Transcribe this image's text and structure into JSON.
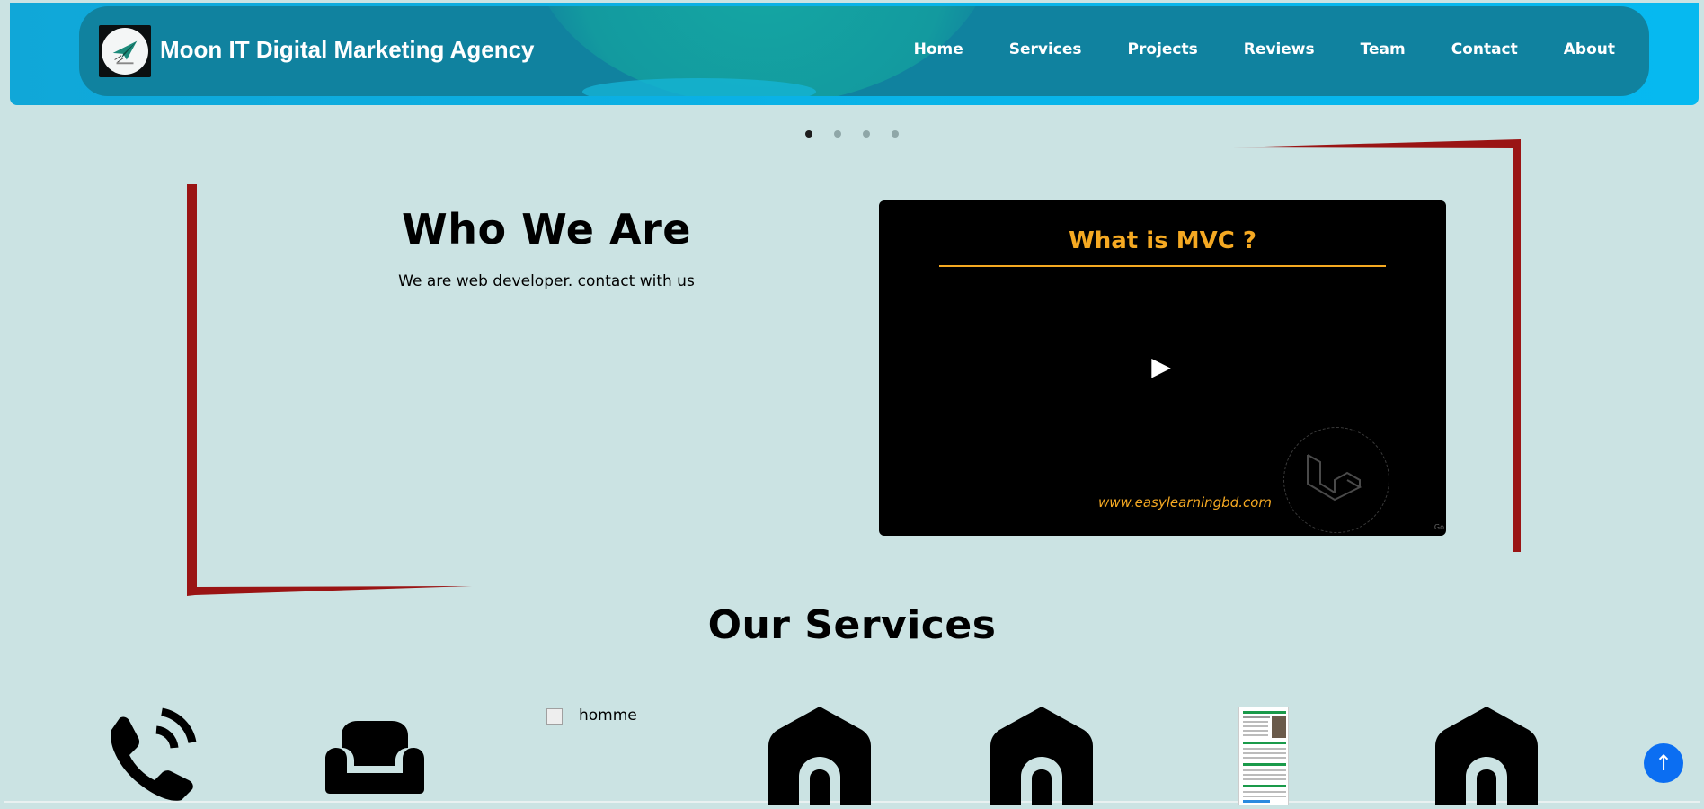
{
  "header": {
    "brand": "Moon IT Digital Marketing Agency",
    "logo_icon": "paper-plane-logo-icon",
    "nav": [
      "Home",
      "Services",
      "Projects",
      "Reviews",
      "Team",
      "Contact",
      "About"
    ]
  },
  "carousel": {
    "slides": 4,
    "active": 1
  },
  "about": {
    "title": "Who We Are",
    "text": "We are web developer. contact with us"
  },
  "video": {
    "title": "What is MVC ?",
    "url": "www.easylearningbd.com",
    "play_icon": "play-icon",
    "watermark_icon": "laravel-logo-icon"
  },
  "services": {
    "title": "Our Services",
    "items": [
      {
        "icon": "phone-icon"
      },
      {
        "icon": "couch-icon"
      },
      {
        "icon": "broken-image-icon",
        "alt": "homme"
      },
      {
        "icon": "house-icon"
      },
      {
        "icon": "house-icon"
      },
      {
        "icon": "document-thumbnail-icon"
      },
      {
        "icon": "house-icon"
      }
    ]
  },
  "back_to_top": {
    "icon": "arrow-up-icon"
  },
  "colors": {
    "page_bg": "#cbe3e3",
    "header_band": "#08b5ea",
    "navbar": "#10829f",
    "accent_red": "#9a1414",
    "video_accent": "#f5a922",
    "back_to_top": "#0b6ef2"
  }
}
